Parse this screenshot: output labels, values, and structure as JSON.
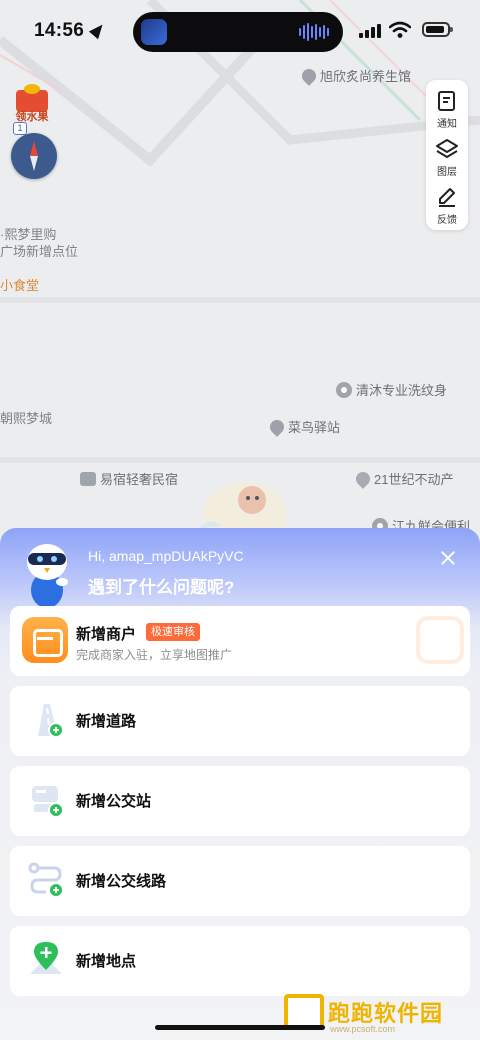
{
  "status_bar": {
    "time": "14:56"
  },
  "map": {
    "pois": [
      {
        "label": "旭欣炙尚养生馆"
      },
      {
        "label": "·熙梦里购"
      },
      {
        "label": "广场新增点位"
      },
      {
        "label": "小食堂"
      },
      {
        "label": "清沐专业洗纹身"
      },
      {
        "label": "朝熙梦城"
      },
      {
        "label": "菜鸟驿站"
      },
      {
        "label": "易宿轻奢民宿"
      },
      {
        "label": "21世纪不动产"
      },
      {
        "label": "江九鲜会便利"
      }
    ],
    "fruit_badge": "领水果",
    "floor": "1"
  },
  "map_controls": {
    "notify": "通知",
    "layers": "图层",
    "feedback": "反馈"
  },
  "sheet": {
    "greeting": "Hi, amap_mpDUAkPyVC",
    "question": "遇到了什么问题呢?",
    "merchant": {
      "title": "新增商户",
      "badge": "极速审核",
      "subtitle": "完成商家入驻，立享地图推广"
    },
    "items": [
      {
        "label": "新增道路"
      },
      {
        "label": "新增公交站"
      },
      {
        "label": "新增公交线路"
      },
      {
        "label": "新增地点"
      }
    ]
  },
  "watermark": {
    "text": "跑跑软件园",
    "url": "www.pcsoft.com"
  },
  "colors": {
    "accent": "#8ea3f7",
    "orange": "#ff8d1d",
    "badge": "#ff6a3a",
    "green": "#2fbf5a"
  }
}
